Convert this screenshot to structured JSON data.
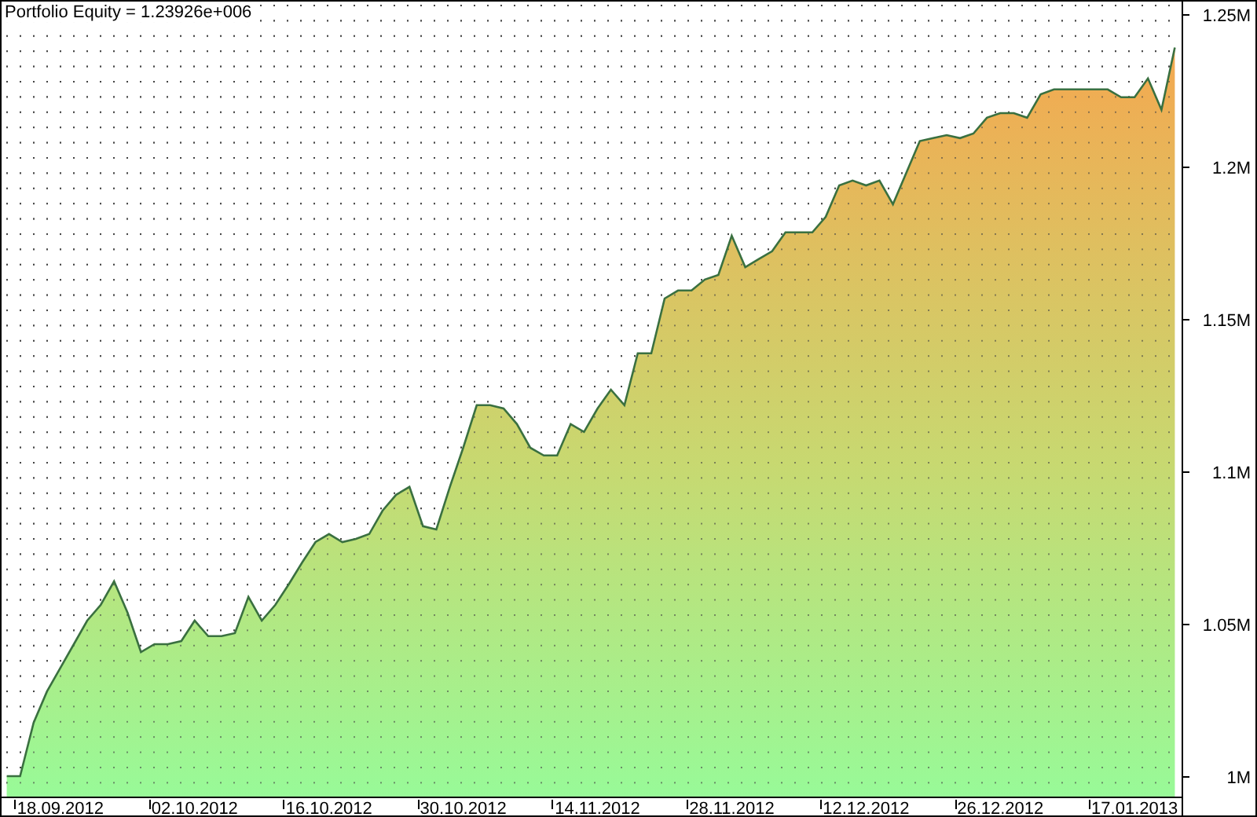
{
  "chart": {
    "title": "Portfolio Equity = 1.23926e+006",
    "chart_data": {
      "type": "area",
      "categories": [
        null,
        null,
        null,
        null,
        "18.09.2012",
        null,
        null,
        null,
        null,
        null,
        null,
        null,
        null,
        null,
        "02.10.2012",
        null,
        null,
        null,
        null,
        null,
        null,
        null,
        null,
        null,
        "16.10.2012",
        null,
        null,
        null,
        null,
        null,
        null,
        null,
        null,
        null,
        "30.10.2012",
        null,
        null,
        null,
        null,
        null,
        null,
        null,
        null,
        null,
        "14.11.2012",
        null,
        null,
        null,
        null,
        null,
        null,
        null,
        null,
        null,
        "28.11.2012",
        null,
        null,
        null,
        null,
        null,
        null,
        null,
        null,
        null,
        "12.12.2012",
        null,
        null,
        null,
        null,
        null,
        null,
        null,
        null,
        null,
        "26.12.2012",
        null,
        null,
        null,
        null,
        null,
        null,
        null,
        null,
        null,
        "17.01.2013",
        null,
        null,
        null
      ],
      "series": [
        {
          "color": "#3a7040",
          "values": [
            1000000,
            1000000,
            1017500,
            1027800,
            1035600,
            1043300,
            1051000,
            1056200,
            1063900,
            1053600,
            1040700,
            1043300,
            1043300,
            1044300,
            1051000,
            1045900,
            1045900,
            1046900,
            1058800,
            1051000,
            1056200,
            1062900,
            1070100,
            1076800,
            1079400,
            1076800,
            1077800,
            1079400,
            1087100,
            1092300,
            1094900,
            1082000,
            1080900,
            1094900,
            1107700,
            1121700,
            1121700,
            1120600,
            1115500,
            1107700,
            1105200,
            1105200,
            1115500,
            1112900,
            1120600,
            1126800,
            1121700,
            1138700,
            1138700,
            1156700,
            1159300,
            1159300,
            1162900,
            1164400,
            1177300,
            1167000,
            1169600,
            1172200,
            1178400,
            1178400,
            1178400,
            1183500,
            1193800,
            1195400,
            1193800,
            1195400,
            1187600,
            1197900,
            1208300,
            1209300,
            1210300,
            1209300,
            1210800,
            1216000,
            1217500,
            1217500,
            1216000,
            1223700,
            1225300,
            1225300,
            1225300,
            1225300,
            1225300,
            1222700,
            1222700,
            1228900,
            1218600,
            1239000
          ]
        }
      ],
      "ylim": [
        993300,
        1254600
      ],
      "yticks": [
        {
          "value": 1000000,
          "label": "1M"
        },
        {
          "value": 1050000,
          "label": "1.05M"
        },
        {
          "value": 1100000,
          "label": "1.1M"
        },
        {
          "value": 1150000,
          "label": "1.15M"
        },
        {
          "value": 1200000,
          "label": "1.2M"
        },
        {
          "value": 1250000,
          "label": "1.25M"
        }
      ]
    }
  }
}
